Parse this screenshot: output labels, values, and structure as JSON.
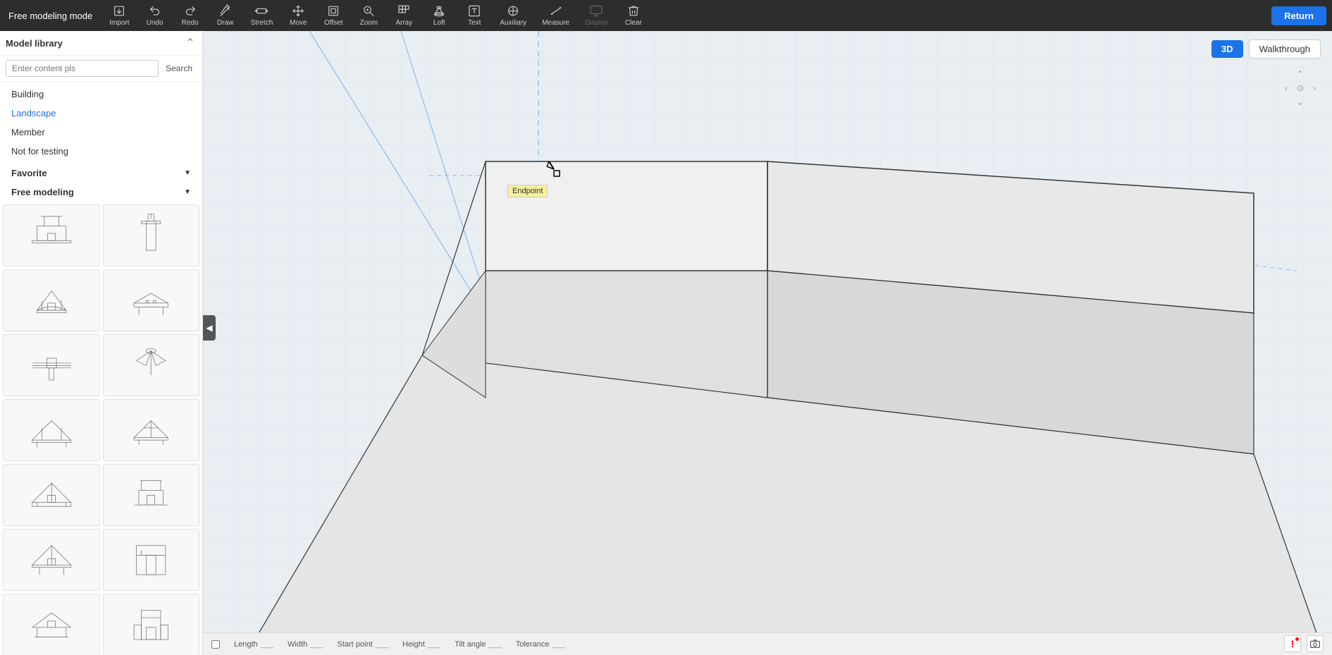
{
  "app": {
    "title": "Free modeling mode",
    "return_label": "Return"
  },
  "toolbar": {
    "tools": [
      {
        "name": "import",
        "label": "Import",
        "icon": "import"
      },
      {
        "name": "undo",
        "label": "Undo",
        "icon": "undo"
      },
      {
        "name": "redo",
        "label": "Redo",
        "icon": "redo"
      },
      {
        "name": "draw",
        "label": "Draw",
        "icon": "draw"
      },
      {
        "name": "stretch",
        "label": "Stretch",
        "icon": "stretch"
      },
      {
        "name": "move",
        "label": "Move",
        "icon": "move"
      },
      {
        "name": "offset",
        "label": "Offset",
        "icon": "offset"
      },
      {
        "name": "zoom",
        "label": "Zoom",
        "icon": "zoom"
      },
      {
        "name": "array",
        "label": "Array",
        "icon": "array"
      },
      {
        "name": "loft",
        "label": "Loft",
        "icon": "loft"
      },
      {
        "name": "text",
        "label": "Text",
        "icon": "text"
      },
      {
        "name": "auxiliary",
        "label": "Auxiliary",
        "icon": "auxiliary"
      },
      {
        "name": "measure",
        "label": "Measure",
        "icon": "measure"
      },
      {
        "name": "display",
        "label": "Display",
        "icon": "display",
        "disabled": true
      },
      {
        "name": "clear",
        "label": "Clear",
        "icon": "clear"
      }
    ]
  },
  "view_controls": {
    "btn_3d": "3D",
    "btn_walkthrough": "Walkthrough"
  },
  "sidebar": {
    "title": "Model library",
    "search_placeholder": "Enter content pls",
    "search_label": "Search",
    "categories": [
      {
        "name": "building",
        "label": "Building"
      },
      {
        "name": "landscape",
        "label": "Landscape",
        "active": true
      },
      {
        "name": "member",
        "label": "Member"
      },
      {
        "name": "not_testing",
        "label": "Not for testing"
      }
    ],
    "sections": [
      {
        "name": "favorite",
        "label": "Favorite"
      },
      {
        "name": "free_modeling",
        "label": "Free modeling"
      }
    ]
  },
  "viewport": {
    "endpoint_label": "Endpoint"
  },
  "statusbar": {
    "fields": [
      {
        "name": "length",
        "label": "Length",
        "value": ""
      },
      {
        "name": "width",
        "label": "Width",
        "value": ""
      },
      {
        "name": "start_point",
        "label": "Start point",
        "value": ""
      },
      {
        "name": "height",
        "label": "Height",
        "value": ""
      },
      {
        "name": "tilt_angle",
        "label": "Tilt angle",
        "value": ""
      },
      {
        "name": "tolerance",
        "label": "Tolerance",
        "value": ""
      }
    ]
  }
}
